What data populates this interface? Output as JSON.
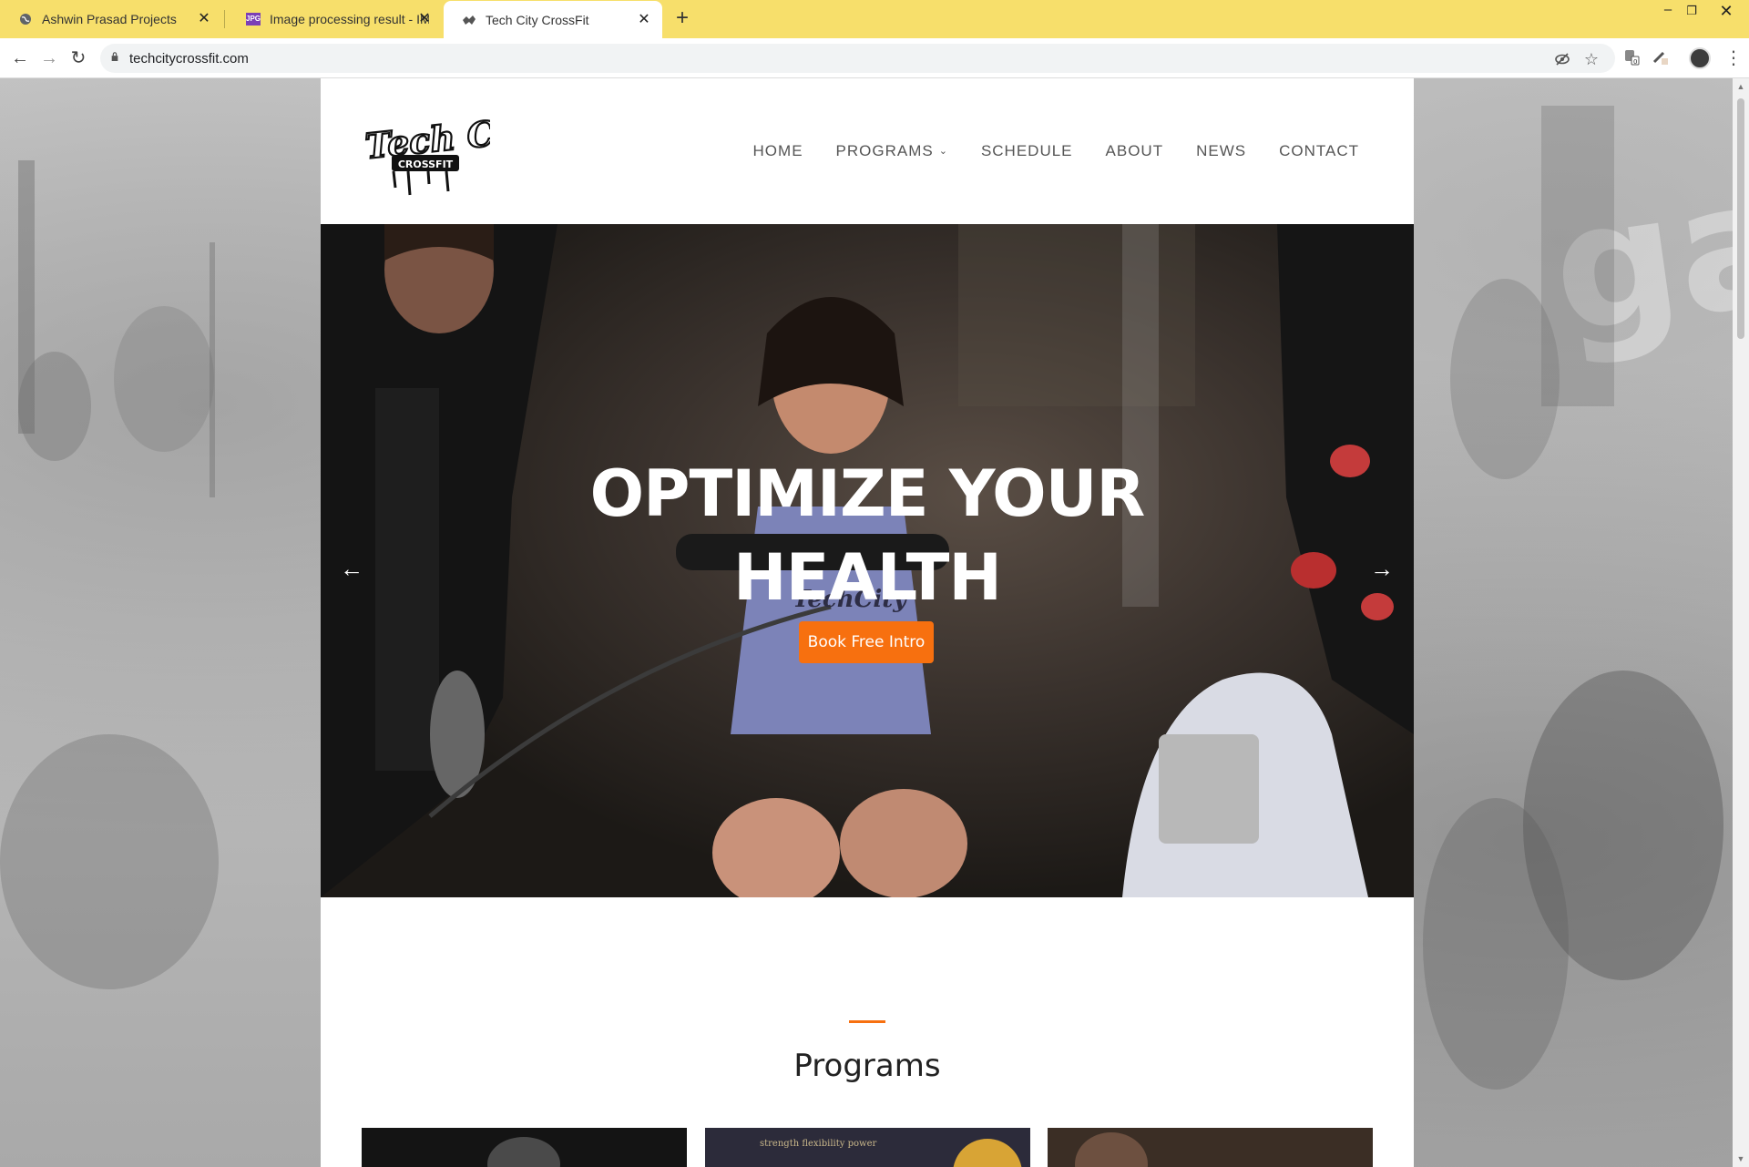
{
  "browser": {
    "tabs": [
      {
        "title": "Ashwin Prasad Projects",
        "active": false
      },
      {
        "title": "Image processing result - IMG o",
        "active": false
      },
      {
        "title": "Tech City CrossFit",
        "active": true
      }
    ],
    "url": "techcitycrossfit.com",
    "tab_favicon_jpg": "JPG"
  },
  "site": {
    "logo_text_top": "Tech City",
    "logo_text_bottom": "CROSSFIT",
    "nav": [
      "HOME",
      "PROGRAMS",
      "SCHEDULE",
      "ABOUT",
      "NEWS",
      "CONTACT"
    ],
    "hero": {
      "title_line1": "OPTIMIZE YOUR",
      "title_line2": "HEALTH",
      "cta": "Book Free Intro",
      "shirt_text": "TechCity"
    },
    "programs": {
      "title": "Programs",
      "card2_text": "strength flexibility power"
    },
    "background_text": "gal"
  },
  "colors": {
    "tabstrip": "#f7df6b",
    "accent": "#f7700f"
  }
}
